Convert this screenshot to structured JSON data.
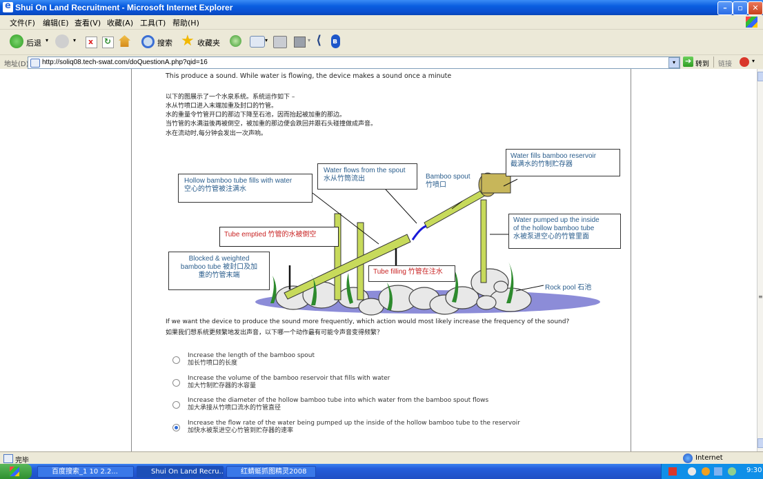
{
  "window": {
    "title": "Shui On Land Recruitment - Microsoft Internet Explorer"
  },
  "menu": [
    "文件(F)",
    "编辑(E)",
    "查看(V)",
    "收藏(A)",
    "工具(T)",
    "帮助(H)"
  ],
  "toolbar": {
    "back": "后退",
    "search": "搜索",
    "favorites": "收藏夹"
  },
  "address": {
    "label": "地址(D)",
    "url": "http://soliq08.tech-swat.com/doQuestionA.php?qid=16",
    "go": "转到",
    "links": "链接"
  },
  "content": {
    "intro_en": "This produce a sound. While water is flowing, the device makes a sound once a minute",
    "intro_zh": [
      "以下的图展示了一个水泉系统。系统运作如下 –",
      "水从竹喷口进入末端加重及封口的竹管。",
      "水的重量令竹管开口的那边下降至石池，因而抬起被加重的那边。",
      "当竹管的水满溢後再被倒空，被加重的那边便会跌回并跟石头碰撞做成声音。",
      "水在流动时,每分钟会发出一次声响。"
    ],
    "diagram": {
      "hollow_tube": [
        "Hollow bamboo tube fills with water",
        "空心的竹管被注满水"
      ],
      "flows_spout": [
        "Water flows from the spout",
        "水从竹筒流出"
      ],
      "bamboo_spout": [
        "Bamboo spout",
        "竹喷口"
      ],
      "reservoir": [
        "Water fills bamboo reservoir",
        "截满水的竹制贮存器"
      ],
      "pumped": [
        "Water pumped up the inside",
        "of the hollow bamboo tube",
        "水被泵进空心的竹管里面"
      ],
      "emptied": "Tube emptied 竹管的水被倒空",
      "filling": "Tube filling 竹管在注水",
      "blocked": [
        "Blocked & weighted",
        "bamboo tube 被封口及加",
        "重的竹管末端"
      ],
      "rock_pool": "Rock pool  石池"
    },
    "question_en": "If we want the device to produce the sound more frequently, which action would most likely increase the frequency of the sound?",
    "question_zh": "如果我们想系统更频繁地发出声音，以下哪一个动作最有可能令声音变得频繁？",
    "options": [
      {
        "en": "Increase the length of the bamboo spout",
        "zh": "加长竹喷口的长度",
        "selected": false
      },
      {
        "en": "Increase the volume of the bamboo reservoir that fills with water",
        "zh": "加大竹制贮存器的水容量",
        "selected": false
      },
      {
        "en": "Increase the diameter of the hollow bamboo tube into which water from the bamboo spout flows",
        "zh": "加大承接从竹喷口流水的竹管直径",
        "selected": false
      },
      {
        "en": "Increase the flow rate of the water being pumped up the inside of the hollow bamboo tube to the reservoir",
        "zh": "加快水被泵进空心竹管到贮存器的速率",
        "selected": true
      }
    ]
  },
  "status": {
    "text": "完毕",
    "zone": "Internet"
  },
  "taskbar": {
    "tasks": [
      "百度搜索_1 10 2.2...",
      "Shui On Land Recru...",
      "红蜻蜓抓图精灵2008"
    ],
    "clock": "9:30"
  }
}
